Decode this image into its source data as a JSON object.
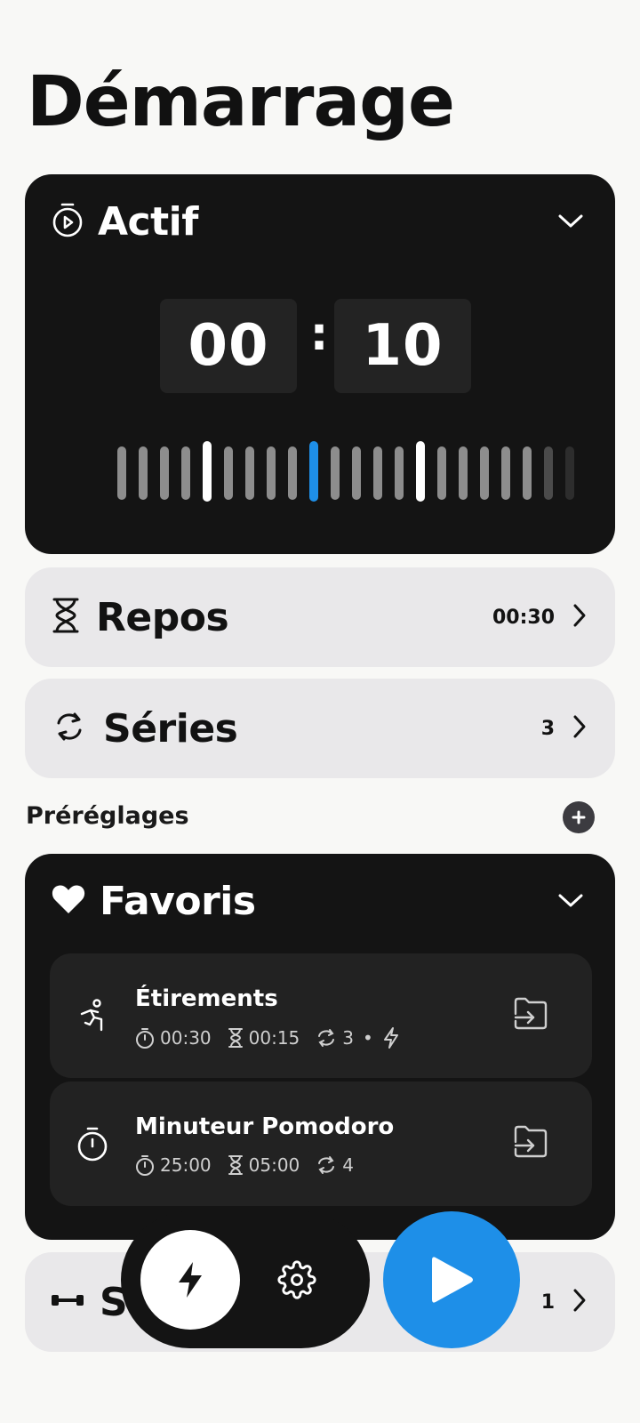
{
  "page": {
    "title": "Démarrage"
  },
  "active": {
    "title": "Actif",
    "minutes": "00",
    "separator": ":",
    "seconds": "10",
    "icon": "timer-play-icon"
  },
  "rest": {
    "title": "Repos",
    "value": "00:30",
    "icon": "hourglass-icon"
  },
  "sets": {
    "title": "Séries",
    "value": "3",
    "icon": "repeat-icon"
  },
  "presets_section": {
    "label": "Préréglages"
  },
  "favorites": {
    "title": "Favoris",
    "items": [
      {
        "name": "Étirements",
        "active": "00:30",
        "rest": "00:15",
        "sets": "3",
        "separator": "•",
        "icon": "stretching-icon"
      },
      {
        "name": "Minuteur Pomodoro",
        "active": "25:00",
        "rest": "05:00",
        "sets": "4",
        "icon": "stopwatch-icon"
      }
    ]
  },
  "bottom_card": {
    "title_visible": "S",
    "value": "1",
    "icon": "dumbbell-icon"
  },
  "colors": {
    "accent": "#1e8fe8",
    "dark_card": "#141414",
    "light_card": "#e9e8ea",
    "background": "#f8f8f6"
  }
}
